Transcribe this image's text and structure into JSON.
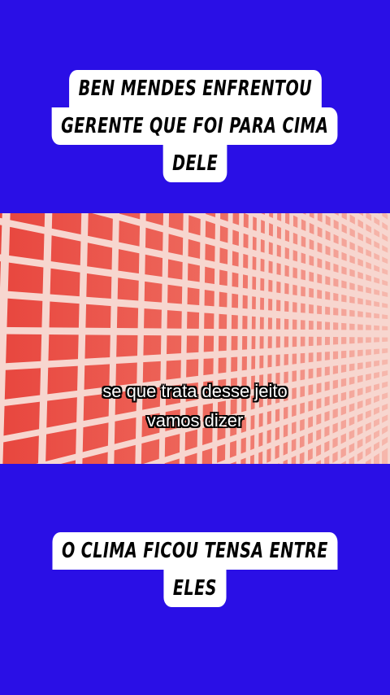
{
  "top_caption": {
    "lines": [
      "BEN MENDES ENFRENTOU",
      "GERENTE QUE FOI PARA CIMA",
      "DELE"
    ]
  },
  "video": {
    "subtitle_lines": [
      "se que trata desse jeito",
      "vamos dizer"
    ]
  },
  "bottom_caption": {
    "lines": [
      "O CLIMA FICOU TENSA ENTRE",
      "ELES"
    ]
  },
  "colors": {
    "background": "#2a0fe6",
    "caption_bg": "#ffffff",
    "video_tile": "#e8463e",
    "video_grout": "#f7d6cf"
  }
}
